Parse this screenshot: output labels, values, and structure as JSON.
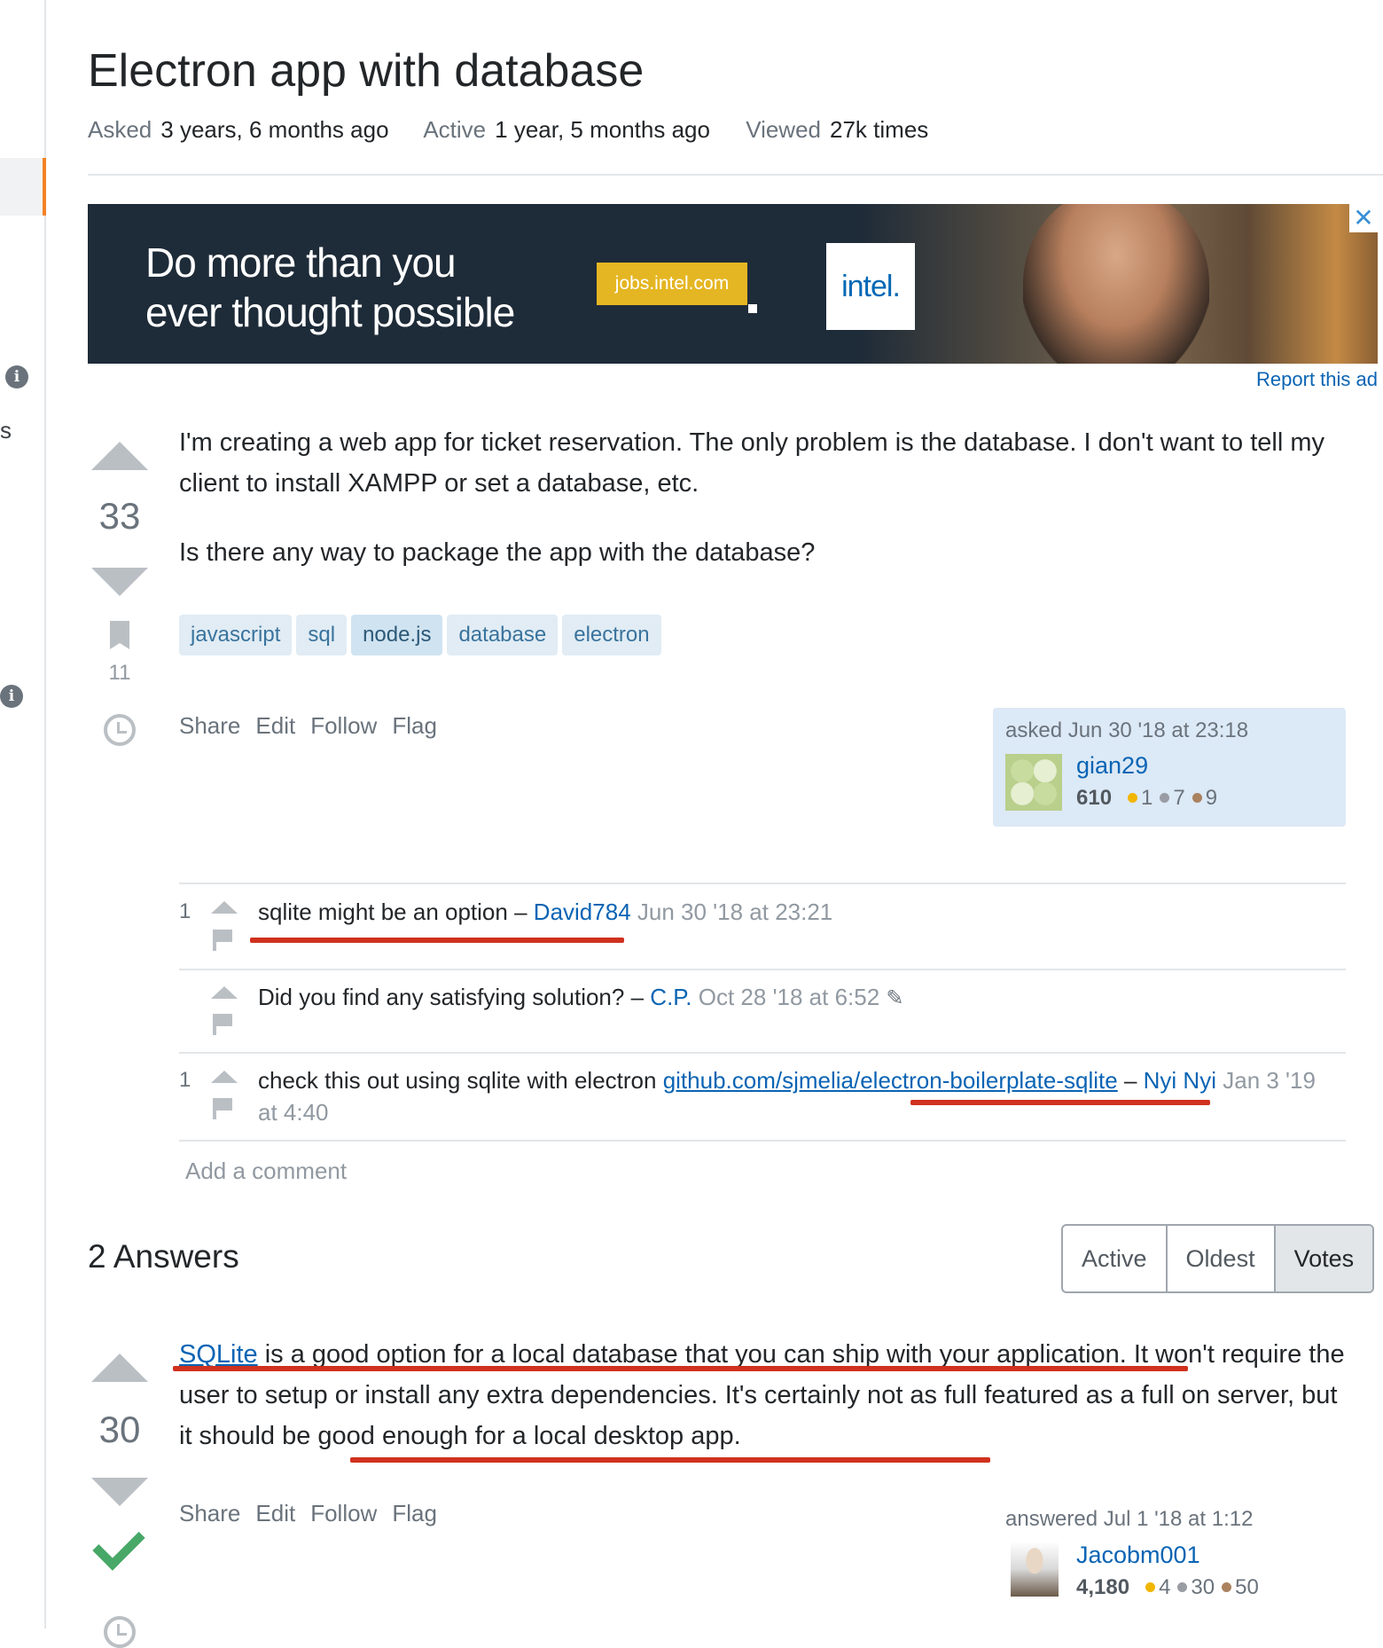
{
  "question": {
    "title": "Electron app with database",
    "meta": {
      "asked_label": "Asked",
      "asked_value": "3 years, 6 months ago",
      "active_label": "Active",
      "active_value": "1 year, 5 months ago",
      "viewed_label": "Viewed",
      "viewed_value": "27k times"
    },
    "votes": "33",
    "bookmarks": "11",
    "body": [
      "I'm creating a web app for ticket reservation. The only problem is the database. I don't want to tell my client to install XAMPP or set a database, etc.",
      "Is there any way to package the app with the database?"
    ],
    "tags": [
      "javascript",
      "sql",
      "node.js",
      "database",
      "electron"
    ],
    "menu": [
      "Share",
      "Edit",
      "Follow",
      "Flag"
    ],
    "owner": {
      "action_time": "asked Jun 30 '18 at 23:18",
      "name": "gian29",
      "reputation": "610",
      "gold": "1",
      "silver": "7",
      "bronze": "9"
    }
  },
  "ad": {
    "headline_line1": "Do more than you",
    "headline_line2": "ever thought possible",
    "badge": "jobs.intel.com",
    "logo": "intel.",
    "close": "✕",
    "report": "Report this ad"
  },
  "sidebar": {
    "partial_letter": "s"
  },
  "comments": [
    {
      "score": "1",
      "text": "sqlite might be an option",
      "sep": "–",
      "user": "David784",
      "date": "Jun 30 '18 at 23:21"
    },
    {
      "score": "",
      "text": "Did you find any satisfying solution?",
      "sep": "–",
      "user": "C.P.",
      "date": "Oct 28 '18 at 6:52"
    },
    {
      "score": "1",
      "text": "check this out using sqlite with electron",
      "link": "github.com/sjmelia/electron-boilerplate-sqlite",
      "sep": "–",
      "user": "Nyi Nyi",
      "date": "Jan 3 '19 at 4:40"
    }
  ],
  "add_comment": "Add a comment",
  "answers": {
    "heading": "2 Answers",
    "sort_tabs": [
      "Active",
      "Oldest",
      "Votes"
    ],
    "items": [
      {
        "votes": "30",
        "link": "SQLite",
        "body_after_link": " is a good option for a local database that you can ship with your application. It won't require the user to setup or install any extra dependencies. It's certainly not as full featured as a full on server, but it should be good enough for a local desktop app.",
        "menu": [
          "Share",
          "Edit",
          "Follow",
          "Flag"
        ],
        "owner": {
          "action_time": "answered Jul 1 '18 at 1:12",
          "name": "Jacobm001",
          "reputation": "4,180",
          "gold": "4",
          "silver": "30",
          "bronze": "50"
        }
      }
    ]
  },
  "colors": {
    "annotation_red": "#d0311f",
    "accent_orange": "#f48225",
    "link_blue": "#0a64b4"
  }
}
